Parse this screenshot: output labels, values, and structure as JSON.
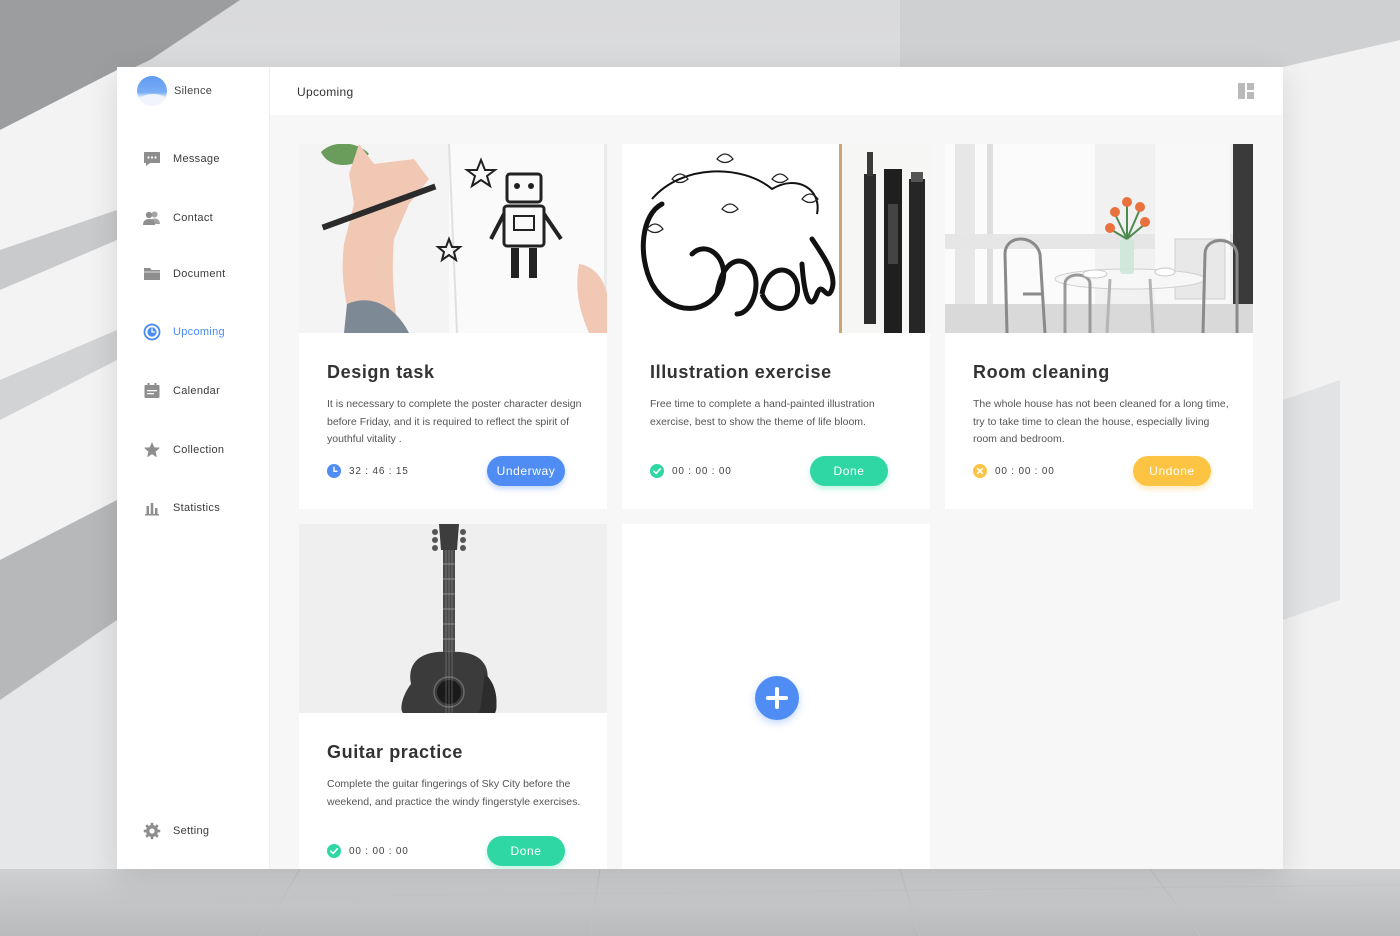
{
  "app": {
    "user_name": "Silence"
  },
  "sidebar": {
    "items": [
      {
        "label": "Message",
        "icon": "message-icon"
      },
      {
        "label": "Contact",
        "icon": "contact-icon"
      },
      {
        "label": "Document",
        "icon": "folder-icon"
      },
      {
        "label": "Upcoming",
        "icon": "clock-icon",
        "active": true
      },
      {
        "label": "Calendar",
        "icon": "calendar-icon"
      },
      {
        "label": "Collection",
        "icon": "star-icon"
      },
      {
        "label": "Statistics",
        "icon": "bar-chart-icon"
      }
    ],
    "setting": {
      "label": "Setting",
      "icon": "gear-icon"
    }
  },
  "header": {
    "title": "Upcoming",
    "layout_icon": "layout-grid-icon"
  },
  "colors": {
    "accent": "#4f8df5",
    "done": "#2ed7a3",
    "undone": "#fdc443",
    "active_nav": "#4a8bf2"
  },
  "cards": [
    {
      "title": "Design task",
      "description": "It is necessary to complete the poster character design before Friday, and it is required to reflect the spirit of youthful vitality .",
      "timer": "32 : 46 : 15",
      "status_icon": "clock-icon",
      "button": "Underway"
    },
    {
      "title": "Illustration exercise",
      "description": "Free time to complete a hand-painted illustration exercise, best to show the theme of life bloom.",
      "timer": "00 : 00 : 00",
      "status_icon": "check-circle-icon",
      "button": "Done"
    },
    {
      "title": "Room cleaning",
      "description": "The whole house has not been cleaned for a long time, try to take time to clean the house, especially living room and bedroom.",
      "timer": "00 : 00 : 00",
      "status_icon": "x-circle-icon",
      "button": "Undone"
    },
    {
      "title": "Guitar practice",
      "description": "Complete the guitar fingerings of Sky City before the weekend, and practice the windy fingerstyle exercises.",
      "timer": "00 : 00 : 00",
      "status_icon": "check-circle-icon",
      "button": "Done"
    }
  ],
  "add_card": {
    "icon": "plus-icon"
  }
}
